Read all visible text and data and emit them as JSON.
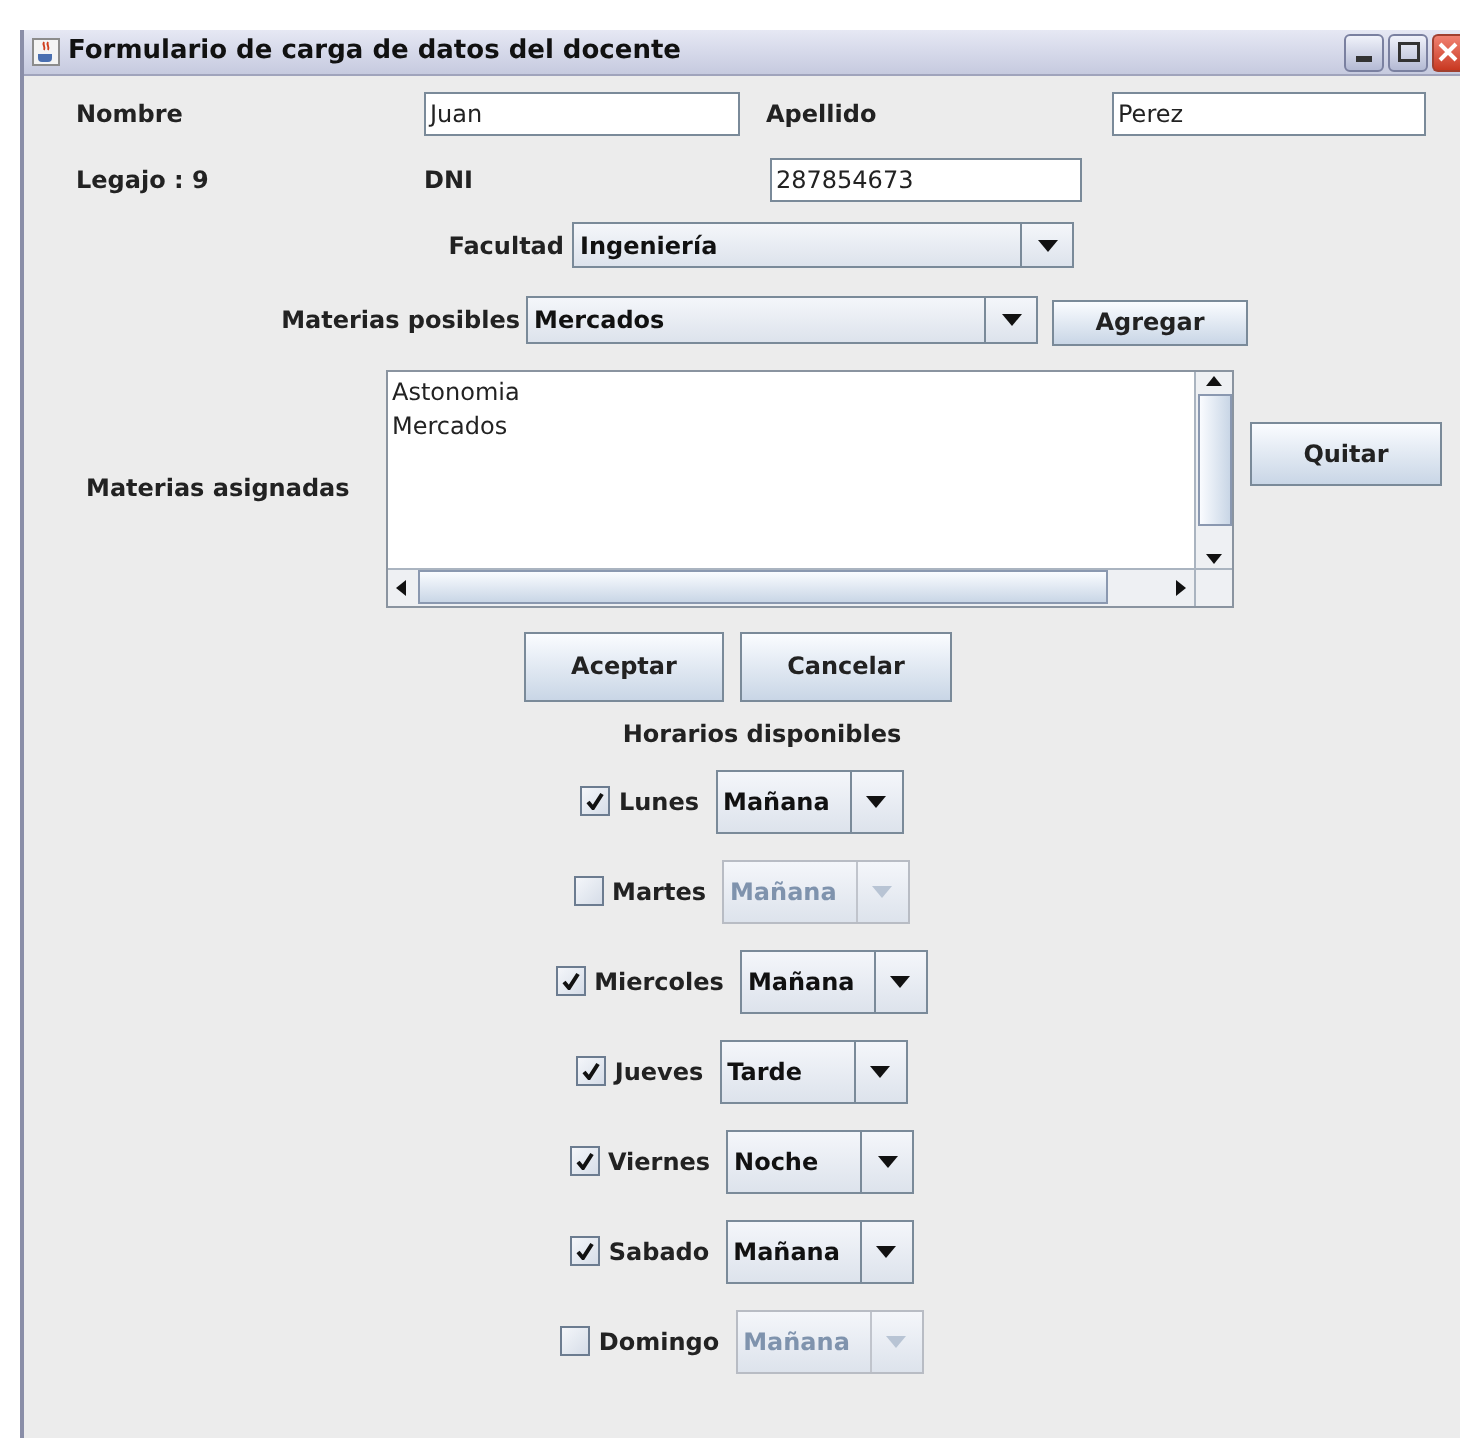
{
  "window": {
    "title": "Formulario de carga de datos del docente"
  },
  "nombre": {
    "label": "Nombre",
    "value": "Juan"
  },
  "apellido": {
    "label": "Apellido",
    "value": "Perez"
  },
  "legajo": "Legajo : 9",
  "dni": {
    "label": "DNI",
    "value": "287854673"
  },
  "facultad": {
    "label": "Facultad",
    "value": "Ingeniería"
  },
  "materias_posibles": {
    "label": "Materias posibles",
    "value": "Mercados",
    "button": "Agregar"
  },
  "materias_asignadas": {
    "label": "Materias asignadas",
    "items": [
      "Astonomia",
      "Mercados"
    ],
    "button": "Quitar"
  },
  "buttons": [
    "Aceptar",
    "Cancelar"
  ],
  "horarios": {
    "title": "Horarios disponibles",
    "days": [
      {
        "label": "Lunes",
        "checked": true,
        "value": "Mañana",
        "disabled": false
      },
      {
        "label": "Martes",
        "checked": false,
        "value": "Mañana",
        "disabled": true
      },
      {
        "label": "Miercoles",
        "checked": true,
        "value": "Mañana",
        "disabled": false
      },
      {
        "label": "Jueves",
        "checked": true,
        "value": "Tarde",
        "disabled": false
      },
      {
        "label": "Viernes",
        "checked": true,
        "value": "Noche",
        "disabled": false
      },
      {
        "label": "Sabado",
        "checked": true,
        "value": "Mañana",
        "disabled": false
      },
      {
        "label": "Domingo",
        "checked": false,
        "value": "Mañana",
        "disabled": true
      }
    ]
  }
}
